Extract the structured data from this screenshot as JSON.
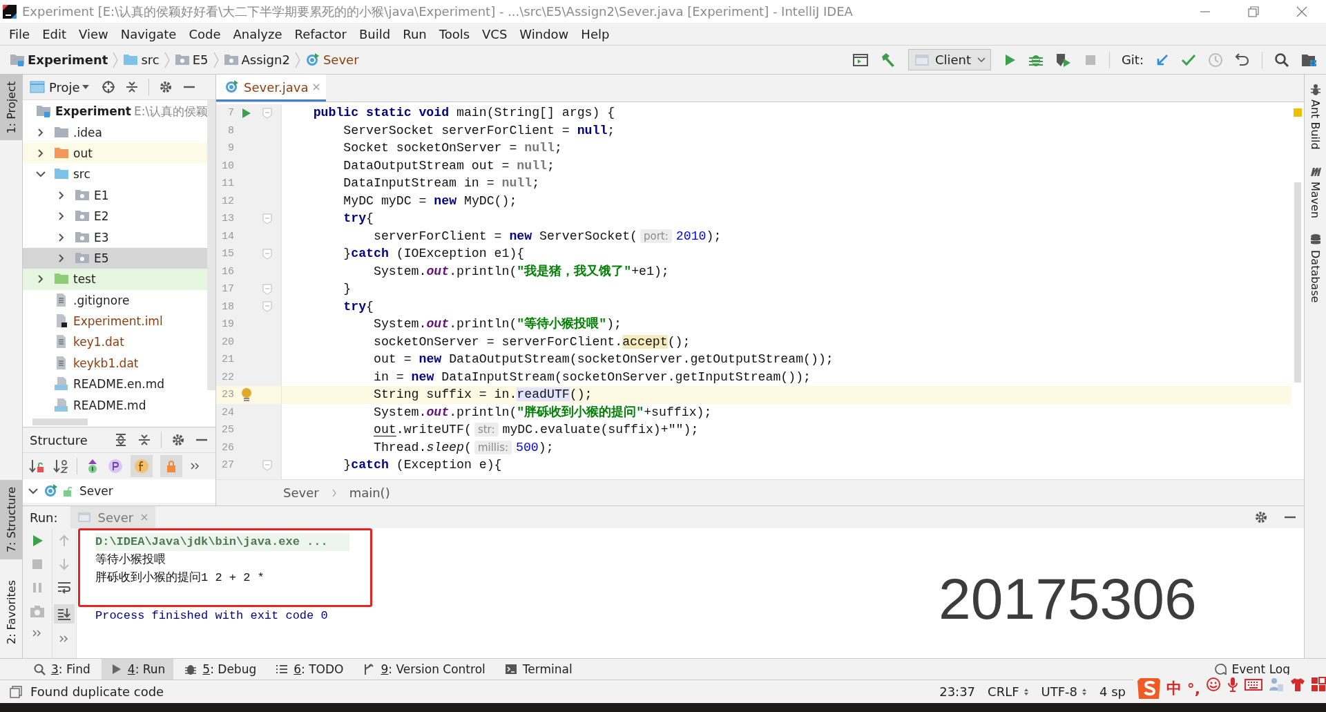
{
  "window": {
    "title": "Experiment [E:\\认真的侯颖好好看\\大二下半学期要累死的的小猴\\java\\Experiment] - ...\\src\\E5\\Assign2\\Sever.java [Experiment] - IntelliJ IDEA"
  },
  "menu": [
    "File",
    "Edit",
    "View",
    "Navigate",
    "Code",
    "Analyze",
    "Refactor",
    "Build",
    "Run",
    "Tools",
    "VCS",
    "Window",
    "Help"
  ],
  "breadcrumbs": [
    {
      "label": "Experiment",
      "kind": "module"
    },
    {
      "label": "src",
      "kind": "source-folder"
    },
    {
      "label": "E5",
      "kind": "package"
    },
    {
      "label": "Assign2",
      "kind": "package"
    },
    {
      "label": "Sever",
      "kind": "class"
    }
  ],
  "toolbar": {
    "run_config": "Client",
    "git_label": "Git:"
  },
  "left_strip": {
    "top": [
      {
        "label": "1: Project",
        "selected": true
      }
    ],
    "bottom": [
      {
        "label": "7: Structure",
        "selected": true
      },
      {
        "label": "2: Favorites",
        "selected": false
      }
    ]
  },
  "right_strip": [
    {
      "label": "Ant Build",
      "kind": "ant"
    },
    {
      "label": "Maven",
      "kind": "maven"
    },
    {
      "label": "Database",
      "kind": "database"
    }
  ],
  "project": {
    "title": "Proje",
    "tree": {
      "label": "Experiment",
      "path": "E:\\认真的侯颖",
      "kind": "module",
      "selected": false,
      "unversioned": false,
      "children": [
        {
          "label": ".idea",
          "kind": "folder",
          "expanded": false,
          "selected": false,
          "unversioned": false
        },
        {
          "label": "out",
          "kind": "excluded-folder",
          "expanded": false,
          "selected": false,
          "unversioned": false
        },
        {
          "label": "src",
          "kind": "source-folder",
          "expanded": true,
          "selected": false,
          "unversioned": false,
          "children": [
            {
              "label": "E1",
              "kind": "package",
              "expanded": false,
              "selected": false,
              "unversioned": false
            },
            {
              "label": "E2",
              "kind": "package",
              "expanded": false,
              "selected": false,
              "unversioned": false
            },
            {
              "label": "E3",
              "kind": "package",
              "expanded": false,
              "selected": false,
              "unversioned": false
            },
            {
              "label": "E5",
              "kind": "package",
              "expanded": false,
              "selected": true,
              "unversioned": false
            }
          ]
        },
        {
          "label": "test",
          "kind": "test-folder",
          "expanded": false,
          "selected": false,
          "unversioned": false
        },
        {
          "label": ".gitignore",
          "kind": "file",
          "selected": false,
          "unversioned": false
        },
        {
          "label": "Experiment.iml",
          "kind": "iml-file",
          "selected": false,
          "unversioned": true
        },
        {
          "label": "key1.dat",
          "kind": "file",
          "selected": false,
          "unversioned": true
        },
        {
          "label": "keykb1.dat",
          "kind": "file",
          "selected": false,
          "unversioned": true
        },
        {
          "label": "README.en.md",
          "kind": "md-file",
          "selected": false,
          "unversioned": false
        },
        {
          "label": "README.md",
          "kind": "md-file",
          "selected": false,
          "unversioned": false
        }
      ]
    }
  },
  "structure": {
    "title": "Structure",
    "items": [
      {
        "label": "Sever",
        "expanded": true
      }
    ]
  },
  "editor": {
    "tabs": [
      {
        "label": "Sever.java",
        "selected": true
      }
    ],
    "lines": [
      {
        "number": "7",
        "run_marker": true,
        "bulb": false,
        "fold": true,
        "current": false,
        "tokens": [
          {
            "kind": "kw",
            "text": "    public static void"
          },
          {
            "kind": "p",
            "text": " main(String[] args) {"
          }
        ]
      },
      {
        "number": "8",
        "run_marker": false,
        "bulb": false,
        "fold": false,
        "current": false,
        "tokens": [
          {
            "kind": "p",
            "text": "        ServerSocket serverForClient = "
          },
          {
            "kind": "kw",
            "text": "null"
          },
          {
            "kind": "p",
            "text": ";"
          }
        ]
      },
      {
        "number": "9",
        "run_marker": false,
        "bulb": false,
        "fold": false,
        "current": false,
        "tokens": [
          {
            "kind": "p",
            "text": "        Socket socketOnServer = "
          },
          {
            "kind": "unused",
            "text": "null"
          },
          {
            "kind": "p",
            "text": ";"
          }
        ]
      },
      {
        "number": "10",
        "run_marker": false,
        "bulb": false,
        "fold": false,
        "current": false,
        "tokens": [
          {
            "kind": "p",
            "text": "        DataOutputStream out = "
          },
          {
            "kind": "unused",
            "text": "null"
          },
          {
            "kind": "p",
            "text": ";"
          }
        ]
      },
      {
        "number": "11",
        "run_marker": false,
        "bulb": false,
        "fold": false,
        "current": false,
        "tokens": [
          {
            "kind": "p",
            "text": "        DataInputStream in = "
          },
          {
            "kind": "unused",
            "text": "null"
          },
          {
            "kind": "p",
            "text": ";"
          }
        ]
      },
      {
        "number": "12",
        "run_marker": false,
        "bulb": false,
        "fold": false,
        "current": false,
        "tokens": [
          {
            "kind": "p",
            "text": "        MyDC myDC = "
          },
          {
            "kind": "kw",
            "text": "new"
          },
          {
            "kind": "p",
            "text": " MyDC();"
          }
        ]
      },
      {
        "number": "13",
        "run_marker": false,
        "bulb": false,
        "fold": true,
        "current": false,
        "tokens": [
          {
            "kind": "kw",
            "text": "        try"
          },
          {
            "kind": "p",
            "text": "{"
          }
        ]
      },
      {
        "number": "14",
        "run_marker": false,
        "bulb": false,
        "fold": false,
        "current": false,
        "tokens": [
          {
            "kind": "p",
            "text": "            serverForClient = "
          },
          {
            "kind": "kw",
            "text": "new"
          },
          {
            "kind": "p",
            "text": " ServerSocket("
          },
          {
            "kind": "hint",
            "text": "port:"
          },
          {
            "kind": "num",
            "text": "2010"
          },
          {
            "kind": "p",
            "text": ");"
          }
        ]
      },
      {
        "number": "15",
        "run_marker": false,
        "bulb": false,
        "fold": true,
        "current": false,
        "tokens": [
          {
            "kind": "p",
            "text": "        }"
          },
          {
            "kind": "kw",
            "text": "catch"
          },
          {
            "kind": "p",
            "text": " (IOException e1){"
          }
        ]
      },
      {
        "number": "16",
        "run_marker": false,
        "bulb": false,
        "fold": false,
        "current": false,
        "tokens": [
          {
            "kind": "p",
            "text": "            System."
          },
          {
            "kind": "field",
            "text": "out"
          },
          {
            "kind": "p",
            "text": ".println("
          },
          {
            "kind": "str",
            "text": "\"我是猪，我又饿了\""
          },
          {
            "kind": "p",
            "text": "+e1);"
          }
        ]
      },
      {
        "number": "17",
        "run_marker": false,
        "bulb": false,
        "fold": true,
        "current": false,
        "tokens": [
          {
            "kind": "p",
            "text": "        }"
          }
        ]
      },
      {
        "number": "18",
        "run_marker": false,
        "bulb": false,
        "fold": true,
        "current": false,
        "tokens": [
          {
            "kind": "kw",
            "text": "        try"
          },
          {
            "kind": "p",
            "text": "{"
          }
        ]
      },
      {
        "number": "19",
        "run_marker": false,
        "bulb": false,
        "fold": false,
        "current": false,
        "tokens": [
          {
            "kind": "p",
            "text": "            System."
          },
          {
            "kind": "field",
            "text": "out"
          },
          {
            "kind": "p",
            "text": ".println("
          },
          {
            "kind": "str",
            "text": "\"等待小猴投喂\""
          },
          {
            "kind": "p",
            "text": ");"
          }
        ]
      },
      {
        "number": "20",
        "run_marker": false,
        "bulb": false,
        "fold": false,
        "current": false,
        "tokens": [
          {
            "kind": "p",
            "text": "            socketOnServer = serverForClient."
          },
          {
            "kind": "usage",
            "text": "accept"
          },
          {
            "kind": "p",
            "text": "();"
          }
        ]
      },
      {
        "number": "21",
        "run_marker": false,
        "bulb": false,
        "fold": false,
        "current": false,
        "tokens": [
          {
            "kind": "p",
            "text": "            out = "
          },
          {
            "kind": "kw",
            "text": "new"
          },
          {
            "kind": "p",
            "text": " DataOutputStream(socketOnServer.getOutputStream());"
          }
        ]
      },
      {
        "number": "22",
        "run_marker": false,
        "bulb": false,
        "fold": false,
        "current": false,
        "tokens": [
          {
            "kind": "p",
            "text": "            in = "
          },
          {
            "kind": "kw",
            "text": "new"
          },
          {
            "kind": "p",
            "text": " DataInputStream(socketOnServer.getInputStream());"
          }
        ]
      },
      {
        "number": "23",
        "run_marker": false,
        "bulb": true,
        "fold": false,
        "current": true,
        "tokens": [
          {
            "kind": "p",
            "text": "            String suffix = in."
          },
          {
            "kind": "ref",
            "text": "readUTF"
          },
          {
            "kind": "p",
            "text": "();"
          }
        ]
      },
      {
        "number": "24",
        "run_marker": false,
        "bulb": false,
        "fold": false,
        "current": false,
        "tokens": [
          {
            "kind": "p",
            "text": "            System."
          },
          {
            "kind": "field",
            "text": "out"
          },
          {
            "kind": "p",
            "text": ".println("
          },
          {
            "kind": "str",
            "text": "\"胖砾收到小猴的提问\""
          },
          {
            "kind": "p",
            "text": "+suffix);"
          }
        ]
      },
      {
        "number": "25",
        "run_marker": false,
        "bulb": false,
        "fold": false,
        "current": false,
        "tokens": [
          {
            "kind": "under",
            "text": "            out"
          },
          {
            "kind": "p",
            "text": ".writeUTF("
          },
          {
            "kind": "hint",
            "text": "str:"
          },
          {
            "kind": "p",
            "text": "myDC.evaluate(suffix)+\"\");"
          }
        ]
      },
      {
        "number": "26",
        "run_marker": false,
        "bulb": false,
        "fold": false,
        "current": false,
        "tokens": [
          {
            "kind": "p",
            "text": "            Thread."
          },
          {
            "kind": "static",
            "text": "sleep"
          },
          {
            "kind": "p",
            "text": "("
          },
          {
            "kind": "hint",
            "text": "millis:"
          },
          {
            "kind": "num",
            "text": "500"
          },
          {
            "kind": "p",
            "text": ");"
          }
        ]
      },
      {
        "number": "27",
        "run_marker": false,
        "bulb": false,
        "fold": true,
        "current": false,
        "tokens": [
          {
            "kind": "p",
            "text": "        }"
          },
          {
            "kind": "kw",
            "text": "catch"
          },
          {
            "kind": "p",
            "text": " (Exception e){"
          }
        ]
      }
    ],
    "breadcrumbs": [
      "Sever",
      "main()"
    ]
  },
  "run": {
    "label": "Run:",
    "tabs": [
      {
        "label": "Sever",
        "selected": true
      }
    ],
    "console": [
      {
        "kind": "command",
        "text": "D:\\IDEA\\Java\\jdk\\bin\\java.exe ...",
        "boxed": true
      },
      {
        "kind": "output",
        "text": "等待小猴投喂",
        "boxed": true
      },
      {
        "kind": "output",
        "text": "胖砾收到小猴的提问1 2 + 2 *",
        "boxed": true
      },
      {
        "kind": "blank",
        "boxed": true
      },
      {
        "kind": "exit",
        "text": "Process finished with exit code 0",
        "boxed": false
      }
    ],
    "overlay_text": "20175306"
  },
  "tool_windows": [
    {
      "label": "3: Find",
      "kind": "find",
      "selected": false
    },
    {
      "label": "4: Run",
      "kind": "run",
      "selected": true
    },
    {
      "label": "5: Debug",
      "kind": "debug",
      "selected": false
    },
    {
      "label": "6: TODO",
      "kind": "todo",
      "selected": false
    },
    {
      "label": "9: Version Control",
      "kind": "vcs",
      "selected": false
    },
    {
      "label": "Terminal",
      "kind": "terminal",
      "selected": false
    }
  ],
  "event_log": "Event Log",
  "status": {
    "message": "Found duplicate code",
    "position": "23:37",
    "line_separator": "CRLF",
    "encoding": "UTF-8",
    "indent": "4 sp"
  },
  "ime": [
    {
      "kind": "logo"
    },
    {
      "kind": "text",
      "text": "中"
    },
    {
      "kind": "text",
      "text": "°,"
    },
    {
      "kind": "smiley"
    },
    {
      "kind": "mic"
    },
    {
      "kind": "keyboard"
    },
    {
      "kind": "person"
    },
    {
      "kind": "shirt"
    },
    {
      "kind": "grid"
    }
  ]
}
